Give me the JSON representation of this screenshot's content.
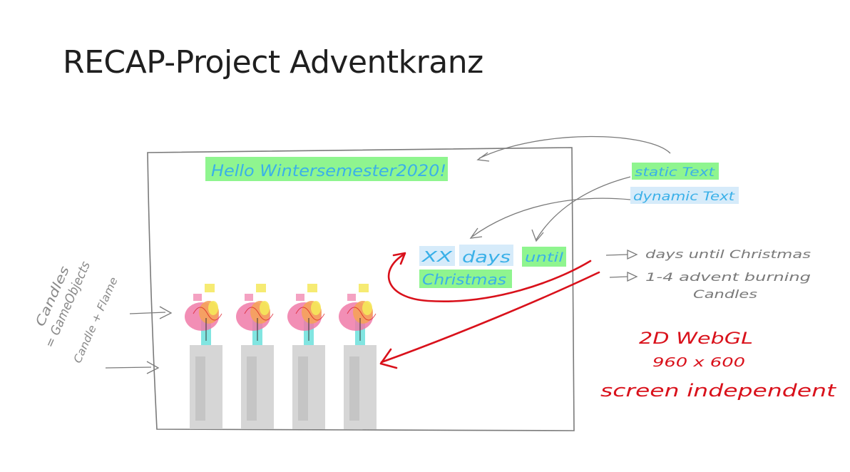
{
  "slide": {
    "title": "RECAP-Project Adventkranz"
  },
  "canvas_texts": {
    "greeting": "Hello Wintersemester2020!",
    "countdown_xx": "XX",
    "countdown_days": "days",
    "countdown_until": "until",
    "countdown_christmas": "Christmas"
  },
  "legend": {
    "static_text": "static Text",
    "dynamic_text": "dynamic Text"
  },
  "right_notes": {
    "days_until": "days until Christmas",
    "advent_line1": "1-4 advent burning",
    "advent_line2": "Candles"
  },
  "left_notes": {
    "line1": "Candles",
    "line2": "= GameObjects",
    "line3": "Candle + Flame"
  },
  "red_notes": {
    "renderer": "2D WebGL",
    "resolution": "960 x 600",
    "screen": "screen independent"
  },
  "colors": {
    "static_highlight": "#8ff58f",
    "dynamic_highlight": "#d6ebfa",
    "handwriting_blue": "#3ab0e8",
    "annotation_red": "#d9111b",
    "pencil_gray": "#7a7a7a",
    "candle_gray": "#cfcfcf",
    "flame_pink": "#f07aa8",
    "flame_orange": "#f5a25a",
    "flame_yellow": "#f5e85a",
    "wick_cyan": "#6be0dc"
  },
  "candles": {
    "count": 4
  }
}
